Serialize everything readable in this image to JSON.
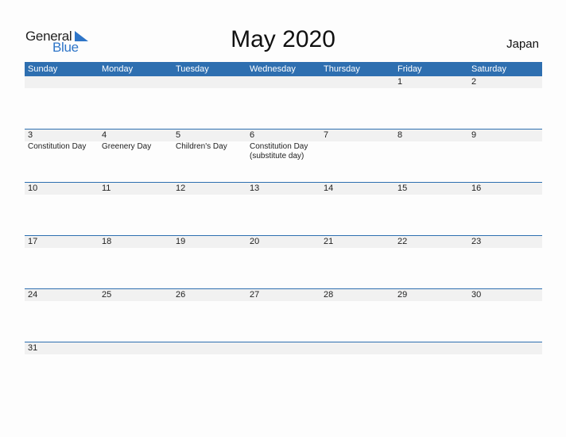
{
  "logo": {
    "word1": "General",
    "word2": "Blue"
  },
  "title": "May 2020",
  "country": "Japan",
  "colors": {
    "header_bg": "#2e6fb0",
    "logo_blue": "#2e75c8",
    "day_bar": "#f1f1f1"
  },
  "weekdays": [
    "Sunday",
    "Monday",
    "Tuesday",
    "Wednesday",
    "Thursday",
    "Friday",
    "Saturday"
  ],
  "weeks": [
    [
      {
        "day": "",
        "holiday": ""
      },
      {
        "day": "",
        "holiday": ""
      },
      {
        "day": "",
        "holiday": ""
      },
      {
        "day": "",
        "holiday": ""
      },
      {
        "day": "",
        "holiday": ""
      },
      {
        "day": "1",
        "holiday": ""
      },
      {
        "day": "2",
        "holiday": ""
      }
    ],
    [
      {
        "day": "3",
        "holiday": "Constitution Day"
      },
      {
        "day": "4",
        "holiday": "Greenery Day"
      },
      {
        "day": "5",
        "holiday": "Children's Day"
      },
      {
        "day": "6",
        "holiday": "Constitution Day (substitute day)"
      },
      {
        "day": "7",
        "holiday": ""
      },
      {
        "day": "8",
        "holiday": ""
      },
      {
        "day": "9",
        "holiday": ""
      }
    ],
    [
      {
        "day": "10",
        "holiday": ""
      },
      {
        "day": "11",
        "holiday": ""
      },
      {
        "day": "12",
        "holiday": ""
      },
      {
        "day": "13",
        "holiday": ""
      },
      {
        "day": "14",
        "holiday": ""
      },
      {
        "day": "15",
        "holiday": ""
      },
      {
        "day": "16",
        "holiday": ""
      }
    ],
    [
      {
        "day": "17",
        "holiday": ""
      },
      {
        "day": "18",
        "holiday": ""
      },
      {
        "day": "19",
        "holiday": ""
      },
      {
        "day": "20",
        "holiday": ""
      },
      {
        "day": "21",
        "holiday": ""
      },
      {
        "day": "22",
        "holiday": ""
      },
      {
        "day": "23",
        "holiday": ""
      }
    ],
    [
      {
        "day": "24",
        "holiday": ""
      },
      {
        "day": "25",
        "holiday": ""
      },
      {
        "day": "26",
        "holiday": ""
      },
      {
        "day": "27",
        "holiday": ""
      },
      {
        "day": "28",
        "holiday": ""
      },
      {
        "day": "29",
        "holiday": ""
      },
      {
        "day": "30",
        "holiday": ""
      }
    ],
    [
      {
        "day": "31",
        "holiday": ""
      },
      {
        "day": "",
        "holiday": ""
      },
      {
        "day": "",
        "holiday": ""
      },
      {
        "day": "",
        "holiday": ""
      },
      {
        "day": "",
        "holiday": ""
      },
      {
        "day": "",
        "holiday": ""
      },
      {
        "day": "",
        "holiday": ""
      }
    ]
  ]
}
